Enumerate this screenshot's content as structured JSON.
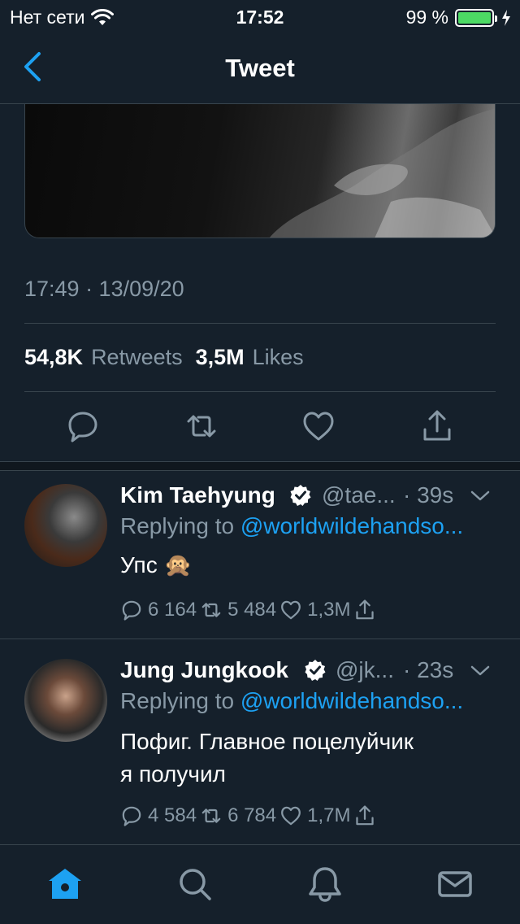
{
  "status_bar": {
    "carrier": "Нет сети",
    "time": "17:52",
    "battery": "99 %",
    "battery_level": 0.99,
    "icons": [
      "wifi-icon",
      "battery-icon",
      "charging-icon"
    ]
  },
  "nav": {
    "title": "Tweet",
    "back_icon": "chevron-left-icon"
  },
  "tweet": {
    "timestamp": "17:49 · 13/09/20",
    "retweets_count": "54,8K",
    "retweets_label": "Retweets",
    "likes_count": "3,5M",
    "likes_label": "Likes",
    "actions": [
      "reply-icon",
      "retweet-icon",
      "like-icon",
      "share-icon"
    ]
  },
  "replies": [
    {
      "name": "Kim Taehyung",
      "handle": "@tae...",
      "time": "· 39s",
      "replying_prefix": "Replying to",
      "replying_to": "@worldwildehandso...",
      "text": "Упс 🙊",
      "text_line2": "",
      "reply_count": "6 164",
      "retweet_count": "5 484",
      "like_count": "1,3M"
    },
    {
      "name": "Jung Jungkook",
      "handle": "@jk...",
      "time": "· 23s",
      "replying_prefix": "Replying to",
      "replying_to": "@worldwildehandso...",
      "text": "Пофиг. Главное поцелуйчик",
      "text_line2": "я получил",
      "reply_count": "4 584",
      "retweet_count": "6 784",
      "like_count": "1,7M"
    }
  ],
  "tab_bar": {
    "tabs": [
      "home-icon",
      "search-icon",
      "notifications-icon",
      "messages-icon"
    ],
    "active": "home-icon"
  },
  "colors": {
    "background": "#15202b",
    "accent": "#1da1f2",
    "secondary_text": "#8899a6",
    "border": "#38444d",
    "battery": "#4cd964"
  }
}
